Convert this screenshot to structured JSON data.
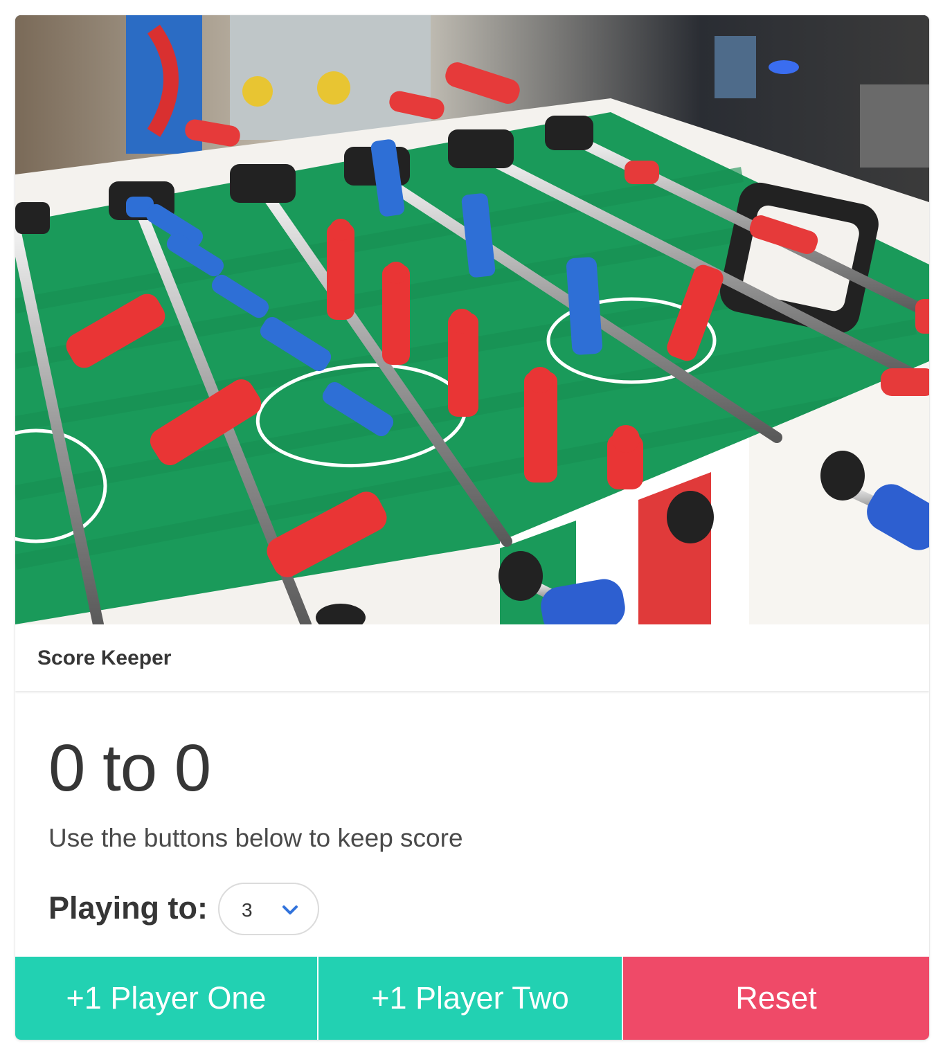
{
  "card": {
    "header_title": "Score Keeper",
    "score_text": "0 to 0",
    "subtitle": "Use the buttons below to keep score",
    "playing_to_label": "Playing to:",
    "playing_to_select": {
      "value": "3",
      "icon": "chevron-down-icon"
    }
  },
  "footer": {
    "player_one_button": "+1 Player One",
    "player_two_button": "+1 Player Two",
    "reset_button": "Reset"
  },
  "colors": {
    "primary_button": "#22d1b2",
    "danger_button": "#ef4a68",
    "text_dark": "#363636",
    "chevron": "#3273dc"
  },
  "hero_image": {
    "subject": "foosball table with red and blue players"
  }
}
